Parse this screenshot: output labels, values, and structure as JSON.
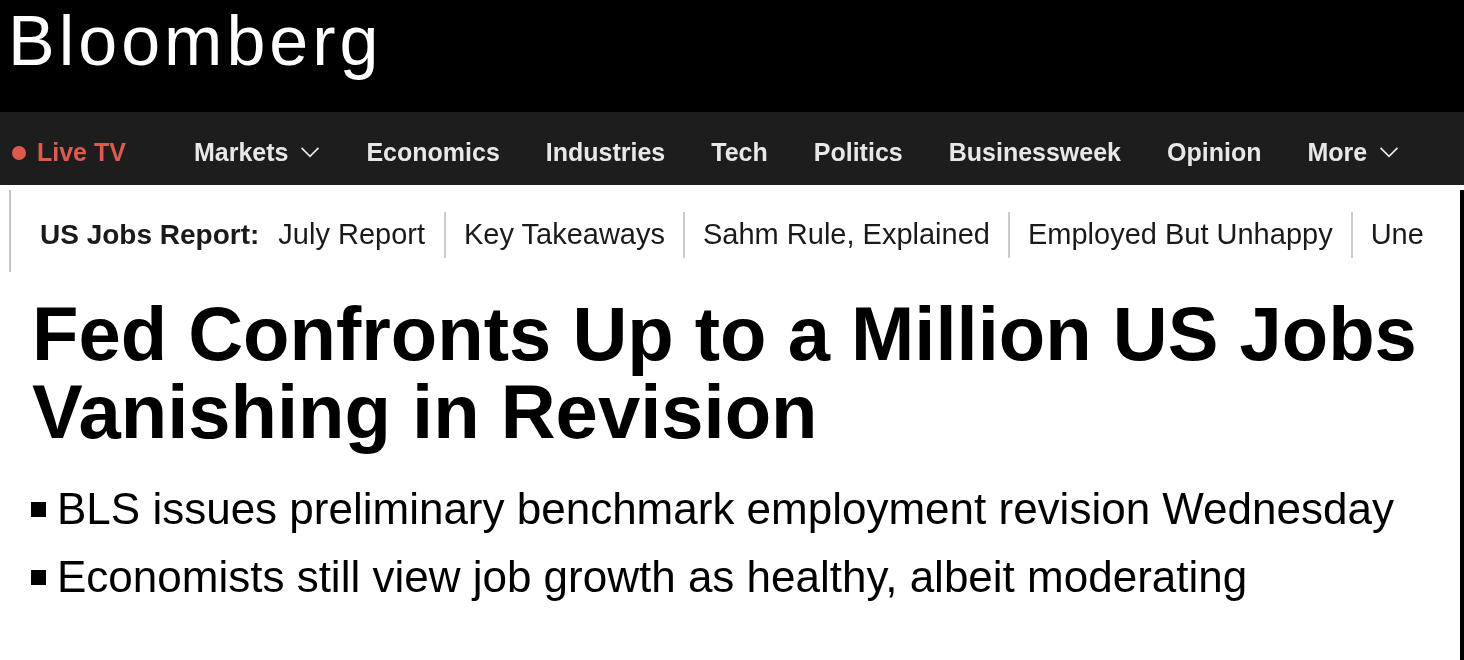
{
  "logo": {
    "text": "Bloomberg"
  },
  "nav": {
    "items": [
      {
        "label": "Live TV",
        "kind": "live"
      },
      {
        "label": "Markets",
        "kind": "dropdown"
      },
      {
        "label": "Economics",
        "kind": "link"
      },
      {
        "label": "Industries",
        "kind": "link"
      },
      {
        "label": "Tech",
        "kind": "link"
      },
      {
        "label": "Politics",
        "kind": "link"
      },
      {
        "label": "Businessweek",
        "kind": "link"
      },
      {
        "label": "Opinion",
        "kind": "link"
      },
      {
        "label": "More",
        "kind": "dropdown"
      }
    ]
  },
  "topic_bar": {
    "title": "US Jobs Report:",
    "links": [
      "July Report",
      "Key Takeaways",
      "Sahm Rule, Explained",
      "Employed But Unhappy",
      "Une"
    ]
  },
  "article": {
    "headline": "Fed Confronts Up to a Million US Jobs Vanishing in Revision",
    "bullets": [
      "BLS issues preliminary benchmark employment revision Wednesday",
      "Economists still view job growth as healthy, albeit moderating"
    ]
  }
}
